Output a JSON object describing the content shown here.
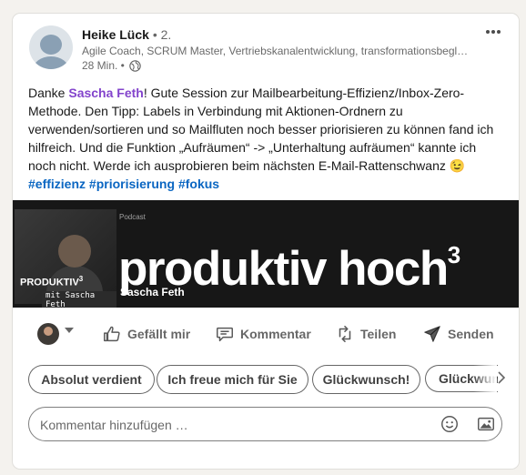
{
  "post": {
    "author": {
      "name": "Heike Lück",
      "degree": " • 2.",
      "headline": "Agile Coach, SCRUM Master, Vertriebskanalentwicklung, transformationsbegl…",
      "time": "28 Min. •",
      "visibility_icon": "globe-icon"
    },
    "more_icon": "more-horizontal-icon",
    "text": {
      "prefix": "Danke ",
      "mention": "Sascha Feth",
      "body": "! Gute Session zur Mailbearbeitung-Effizienz/Inbox-Zero-Methode. Den Tipp: Labels in Verbindung mit Aktionen-Ordnern zu verwenden/sortieren und so Mailfluten noch besser priorisieren zu können fand ich hilfreich. Und die Funktion „Aufräumen“ -> „Unterhaltung aufräumen“ kannte ich noch nicht. Werde ich ausprobieren beim nächsten E-Mail-Rattenschwanz 😉",
      "hashtags": [
        "#effizienz",
        "#priorisierung",
        "#fokus"
      ]
    },
    "media": {
      "podcast_label": "Podcast",
      "title_main": "produktiv hoch",
      "title_sup": "3",
      "host": "Sascha Feth",
      "thumb_title": "PRODUKTIV",
      "thumb_sup": "3",
      "thumb_sub": "mit Sascha Feth"
    }
  },
  "actions": {
    "reaction_avatar": "user-avatar",
    "like": "Gefällt mir",
    "comment": "Kommentar",
    "share": "Teilen",
    "send": "Senden"
  },
  "suggestions": [
    "Absolut verdient",
    "Ich freue mich für Sie",
    "Glückwunsch!",
    "Glückwun"
  ],
  "suggestions_arrow_icon": "chevron-right-icon",
  "comment_box": {
    "placeholder": "Kommentar hinzufügen …",
    "emoji_icon": "emoji-icon",
    "image_icon": "image-icon"
  },
  "colors": {
    "mention": "#8344cc",
    "hashtag": "#0a66c2",
    "background": "#f4f2ee"
  }
}
